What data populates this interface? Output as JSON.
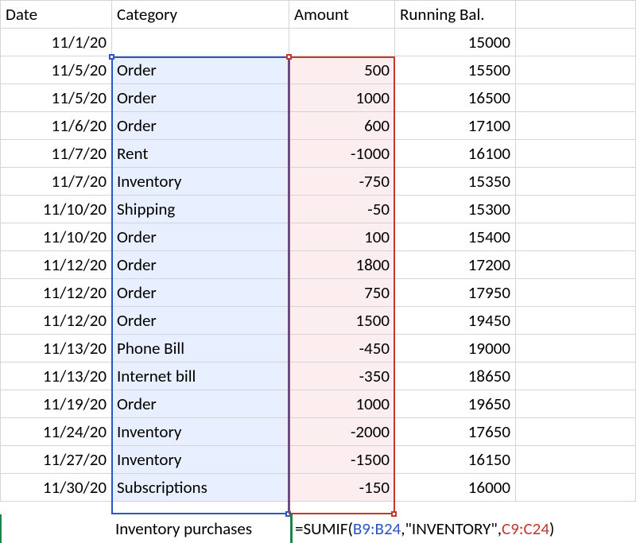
{
  "chart_data": {
    "type": "table",
    "columns": [
      "Date",
      "Category",
      "Amount",
      "Running Bal."
    ],
    "rows": [
      [
        "11/1/20",
        "",
        "",
        15000
      ],
      [
        "11/5/20",
        "Order",
        500,
        15500
      ],
      [
        "11/5/20",
        "Order",
        1000,
        16500
      ],
      [
        "11/6/20",
        "Order",
        600,
        17100
      ],
      [
        "11/7/20",
        "Rent",
        -1000,
        16100
      ],
      [
        "11/7/20",
        "Inventory",
        -750,
        15350
      ],
      [
        "11/10/20",
        "Shipping",
        -50,
        15300
      ],
      [
        "11/10/20",
        "Order",
        100,
        15400
      ],
      [
        "11/12/20",
        "Order",
        1800,
        17200
      ],
      [
        "11/12/20",
        "Order",
        750,
        17950
      ],
      [
        "11/12/20",
        "Order",
        1500,
        19450
      ],
      [
        "11/13/20",
        "Phone Bill",
        -450,
        19000
      ],
      [
        "11/13/20",
        "Internet bill",
        -350,
        18650
      ],
      [
        "11/19/20",
        "Order",
        1000,
        19650
      ],
      [
        "11/24/20",
        "Inventory",
        -2000,
        17650
      ],
      [
        "11/27/20",
        "Inventory",
        -1500,
        16150
      ],
      [
        "11/30/20",
        "Subscriptions",
        -150,
        16000
      ]
    ]
  },
  "headers": {
    "date": "Date",
    "category": "Category",
    "amount": "Amount",
    "balance": "Running Bal."
  },
  "rows": [
    {
      "date": "11/1/20",
      "category": "",
      "amount": "",
      "balance": "15000"
    },
    {
      "date": "11/5/20",
      "category": "Order",
      "amount": "500",
      "balance": "15500"
    },
    {
      "date": "11/5/20",
      "category": "Order",
      "amount": "1000",
      "balance": "16500"
    },
    {
      "date": "11/6/20",
      "category": "Order",
      "amount": "600",
      "balance": "17100"
    },
    {
      "date": "11/7/20",
      "category": "Rent",
      "amount": "-1000",
      "balance": "16100"
    },
    {
      "date": "11/7/20",
      "category": "Inventory",
      "amount": "-750",
      "balance": "15350"
    },
    {
      "date": "11/10/20",
      "category": "Shipping",
      "amount": "-50",
      "balance": "15300"
    },
    {
      "date": "11/10/20",
      "category": "Order",
      "amount": "100",
      "balance": "15400"
    },
    {
      "date": "11/12/20",
      "category": "Order",
      "amount": "1800",
      "balance": "17200"
    },
    {
      "date": "11/12/20",
      "category": "Order",
      "amount": "750",
      "balance": "17950"
    },
    {
      "date": "11/12/20",
      "category": "Order",
      "amount": "1500",
      "balance": "19450"
    },
    {
      "date": "11/13/20",
      "category": "Phone Bill",
      "amount": "-450",
      "balance": "19000"
    },
    {
      "date": "11/13/20",
      "category": "Internet bill",
      "amount": "-350",
      "balance": "18650"
    },
    {
      "date": "11/19/20",
      "category": "Order",
      "amount": "1000",
      "balance": "19650"
    },
    {
      "date": "11/24/20",
      "category": "Inventory",
      "amount": "-2000",
      "balance": "17650"
    },
    {
      "date": "11/27/20",
      "category": "Inventory",
      "amount": "-1500",
      "balance": "16150"
    },
    {
      "date": "11/30/20",
      "category": "Subscriptions",
      "amount": "-150",
      "balance": "16000"
    }
  ],
  "formula_row": {
    "label": "Inventory purchases",
    "prefix": "=SUMIF(",
    "range1": "B9:B24",
    "sep1": ",\"INVENTORY\",",
    "range2": "C9:C24",
    "suffix": ")"
  }
}
